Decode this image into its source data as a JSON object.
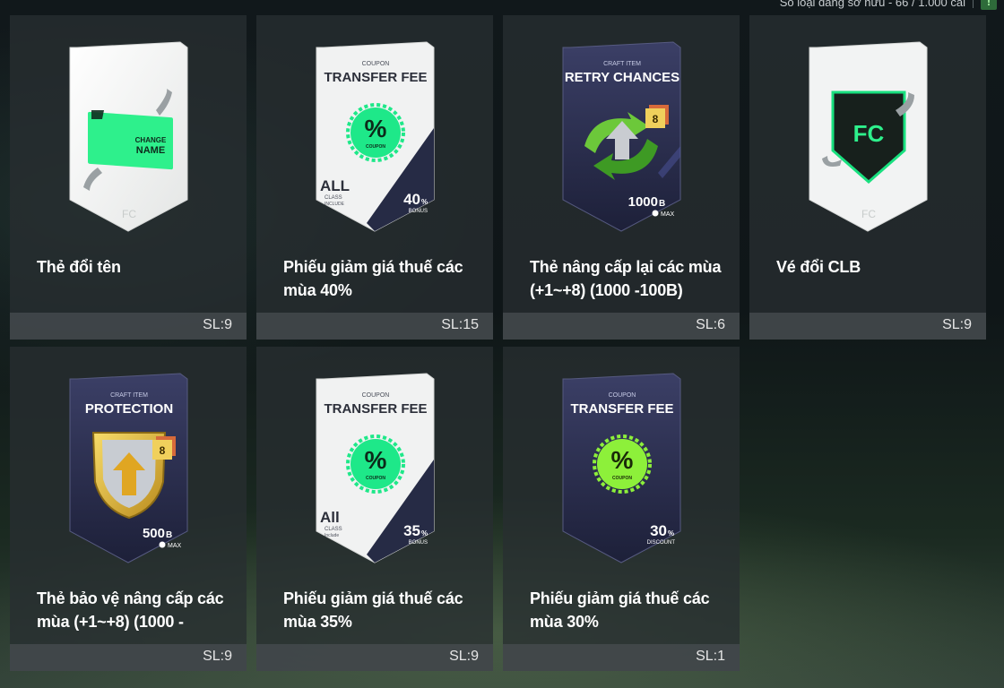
{
  "header": {
    "status_text": "Số loại đang sở hữu - 66 / 1.000 cái"
  },
  "items": [
    {
      "name": "Thẻ đổi tên",
      "qty": "SL:9",
      "card": {
        "line1": "CHANGE",
        "line2": "NAME"
      }
    },
    {
      "name": "Phiếu giảm giá thuế các mùa 40%",
      "qty": "SL:15",
      "card": {
        "kicker": "COUPON",
        "title": "TRANSFER FEE",
        "big": "ALL",
        "small": "CLASS",
        "tiny": "INCLUDE",
        "pct": "40",
        "pct_unit": "%",
        "pct_label": "BONUS",
        "seal": "%",
        "seal_label": "COUPON"
      }
    },
    {
      "name": "Thẻ nâng cấp lại các mùa (+1~+8) (1000 -100B)",
      "qty": "SL:6",
      "card": {
        "kicker": "CRAFT ITEM",
        "title": "RETRY CHANCES",
        "badge": "8",
        "value": "1000",
        "unit": "B",
        "value_label": "MAX"
      }
    },
    {
      "name": "Vé đổi CLB",
      "qty": "SL:9",
      "card": {}
    },
    {
      "name": "Thẻ bảo vệ nâng cấp các mùa (+1~+8) (1000 -",
      "qty": "SL:9",
      "card": {
        "kicker": "CRAFT ITEM",
        "title": "PROTECTION",
        "badge": "8",
        "value": "500",
        "unit": "B",
        "value_label": "MAX"
      }
    },
    {
      "name": "Phiếu giảm giá thuế các mùa 35%",
      "qty": "SL:9",
      "card": {
        "kicker": "COUPON",
        "title": "TRANSFER FEE",
        "big": "All",
        "small": "CLASS",
        "tiny": "Include",
        "pct": "35",
        "pct_unit": "%",
        "pct_label": "BONUS",
        "seal": "%",
        "seal_label": "COUPON"
      }
    },
    {
      "name": "Phiếu giảm giá thuế các mùa 30%",
      "qty": "SL:1",
      "card": {
        "kicker": "COUPON",
        "title": "TRANSFER FEE",
        "pct": "30",
        "pct_unit": "%",
        "pct_label": "DISCOUNT",
        "seal": "%",
        "seal_label": "COUPON"
      }
    }
  ]
}
